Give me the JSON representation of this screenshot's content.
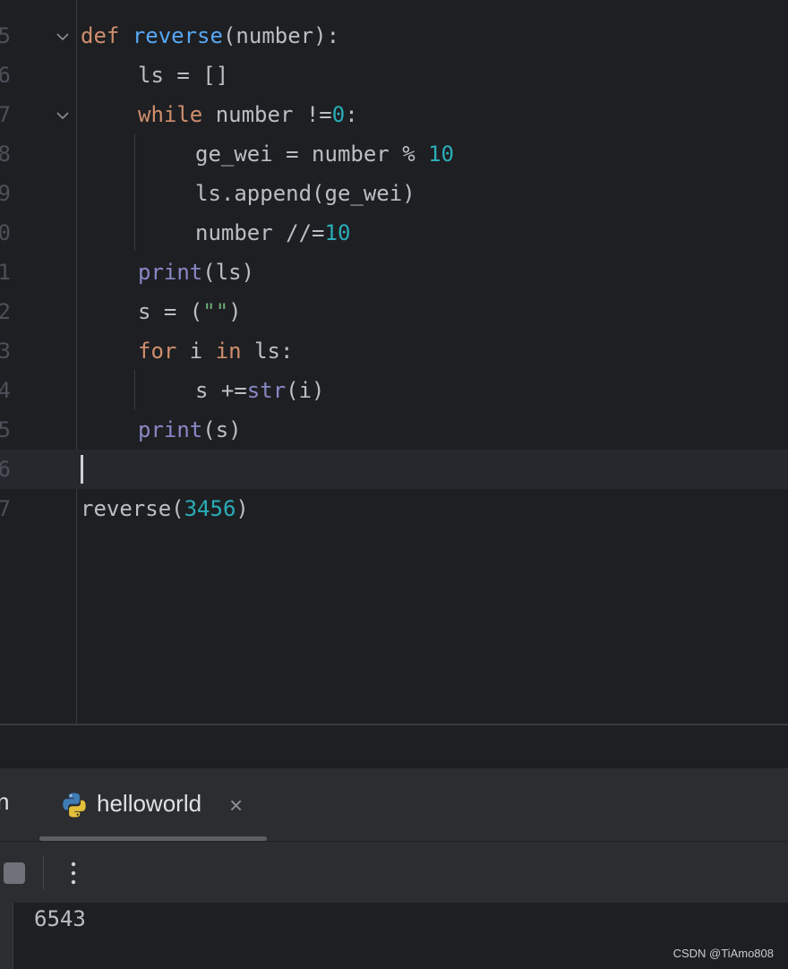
{
  "editor": {
    "lines": [
      {
        "num": "5",
        "fold": true,
        "current": false,
        "indent": 0,
        "tokens": [
          {
            "t": "def",
            "c": "kw"
          },
          {
            "t": " ",
            "c": ""
          },
          {
            "t": "reverse",
            "c": "fn"
          },
          {
            "t": "(number):",
            "c": ""
          }
        ]
      },
      {
        "num": "6",
        "fold": false,
        "current": false,
        "indent": 1,
        "tokens": [
          {
            "t": "ls = []",
            "c": ""
          }
        ]
      },
      {
        "num": "7",
        "fold": true,
        "current": false,
        "indent": 1,
        "tokens": [
          {
            "t": "while",
            "c": "kw"
          },
          {
            "t": " number !=",
            "c": ""
          },
          {
            "t": "0",
            "c": "num"
          },
          {
            "t": ":",
            "c": ""
          }
        ]
      },
      {
        "num": "8",
        "fold": false,
        "current": false,
        "indent": 2,
        "tokens": [
          {
            "t": "ge_wei = number % ",
            "c": ""
          },
          {
            "t": "10",
            "c": "num"
          }
        ]
      },
      {
        "num": "9",
        "fold": false,
        "current": false,
        "indent": 2,
        "tokens": [
          {
            "t": "ls.append(ge_wei)",
            "c": ""
          }
        ]
      },
      {
        "num": "0",
        "fold": false,
        "current": false,
        "indent": 2,
        "tokens": [
          {
            "t": "number //=",
            "c": ""
          },
          {
            "t": "10",
            "c": "num"
          }
        ]
      },
      {
        "num": "1",
        "fold": false,
        "current": false,
        "indent": 1,
        "tokens": [
          {
            "t": "print",
            "c": "bi"
          },
          {
            "t": "(ls)",
            "c": ""
          }
        ]
      },
      {
        "num": "2",
        "fold": false,
        "current": false,
        "indent": 1,
        "tokens": [
          {
            "t": "s = (",
            "c": ""
          },
          {
            "t": "\"\"",
            "c": "str"
          },
          {
            "t": ")",
            "c": ""
          }
        ]
      },
      {
        "num": "3",
        "fold": false,
        "current": false,
        "indent": 1,
        "tokens": [
          {
            "t": "for",
            "c": "kw"
          },
          {
            "t": " i ",
            "c": ""
          },
          {
            "t": "in",
            "c": "kw"
          },
          {
            "t": " ls:",
            "c": ""
          }
        ]
      },
      {
        "num": "4",
        "fold": false,
        "current": false,
        "indent": 2,
        "tokens": [
          {
            "t": "s +=",
            "c": ""
          },
          {
            "t": "str",
            "c": "bi"
          },
          {
            "t": "(i)",
            "c": ""
          }
        ]
      },
      {
        "num": "5",
        "fold": false,
        "current": false,
        "indent": 1,
        "tokens": [
          {
            "t": "print",
            "c": "bi"
          },
          {
            "t": "(s)",
            "c": ""
          }
        ]
      },
      {
        "num": "6",
        "fold": false,
        "current": true,
        "indent": 0,
        "tokens": []
      },
      {
        "num": "7",
        "fold": false,
        "current": false,
        "indent": 0,
        "tokens": [
          {
            "t": "reverse(",
            "c": ""
          },
          {
            "t": "3456",
            "c": "num"
          },
          {
            "t": ")",
            "c": ""
          }
        ]
      }
    ]
  },
  "run_panel": {
    "left_tab_partial": "n",
    "tab_label": "helloworld",
    "tab_icon": "python-icon",
    "close_glyph": "×",
    "more_glyph": "⋮"
  },
  "console": {
    "output": "6543"
  },
  "watermark": "CSDN @TiAmo808",
  "colors": {
    "keyword": "#cf8e6d",
    "function": "#56a8f5",
    "number": "#2aacb8",
    "string": "#6aab73",
    "builtin": "#8888c6",
    "text": "#bcbec4"
  }
}
